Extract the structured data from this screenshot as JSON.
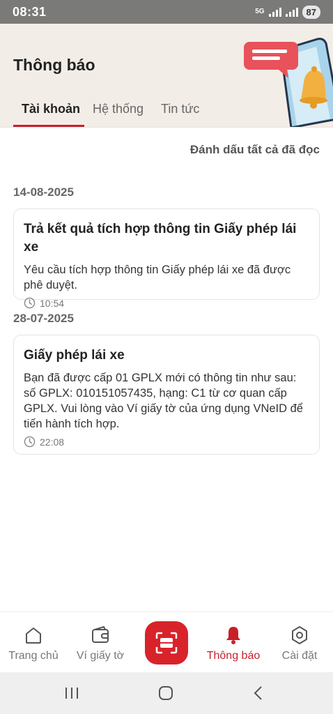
{
  "status_bar": {
    "time": "08:31",
    "network": "5G",
    "battery": "87"
  },
  "header": {
    "title": "Thông báo"
  },
  "tabs": [
    {
      "label": "Tài khoản",
      "active": true
    },
    {
      "label": "Hệ thống",
      "active": false
    },
    {
      "label": "Tin tức",
      "active": false
    }
  ],
  "actions": {
    "mark_all_read": "Đánh dấu tất cả đã đọc"
  },
  "groups": [
    {
      "date": "14-08-2025",
      "items": [
        {
          "title": "Trả kết quả tích hợp thông tin Giấy phép lái xe",
          "body": "Yêu cầu tích hợp thông tin Giấy phép lái xe đã được phê duyệt.",
          "time": "10:54"
        }
      ]
    },
    {
      "date": "28-07-2025",
      "items": [
        {
          "title": "Giấy phép lái xe",
          "body": "Bạn đã được cấp 01 GPLX mới có thông tin như sau: số GPLX: 010151057435, hạng: C1 từ cơ quan cấp GPLX. Vui lòng vào Ví giấy tờ của ứng dụng VNeID để tiến hành tích hợp.",
          "time": "22:08"
        }
      ]
    }
  ],
  "bottom_nav": [
    {
      "label": "Trang chủ",
      "icon": "home-icon",
      "active": false
    },
    {
      "label": "Ví giấy tờ",
      "icon": "wallet-icon",
      "active": false
    },
    {
      "label": "",
      "icon": "scan-icon",
      "active": false
    },
    {
      "label": "Thông báo",
      "icon": "bell-icon",
      "active": true
    },
    {
      "label": "Cài đặt",
      "icon": "settings-icon",
      "active": false
    }
  ],
  "colors": {
    "accent": "#c8202a",
    "header_bg": "#f3ede7",
    "scan_bg": "#d8232a"
  }
}
